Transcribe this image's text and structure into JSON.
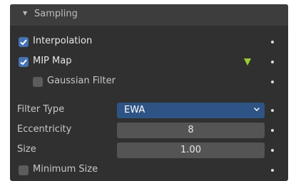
{
  "panel": {
    "title": "Sampling",
    "interpolation": {
      "label": "Interpolation",
      "checked": true
    },
    "mip_map": {
      "label": "MIP Map",
      "checked": true
    },
    "gaussian_filter": {
      "label": "Gaussian Filter",
      "checked": false
    },
    "filter_type": {
      "label": "Filter Type",
      "value": "EWA"
    },
    "eccentricity": {
      "label": "Eccentricity",
      "value": "8"
    },
    "size": {
      "label": "Size",
      "value": "1.00"
    },
    "minimum_size": {
      "label": "Minimum Size",
      "checked": false
    }
  },
  "icons": {
    "collapse": "triangle-down-icon",
    "checkmark": "checkmark-icon",
    "keyframe": "keyframe-icon",
    "dropdown": "chevron-down-icon",
    "animate": "animate-dot-icon"
  },
  "colors": {
    "panel_bg": "#303030",
    "header_bg": "#3d3d3d",
    "checkbox_on": "#4772b3",
    "select_bg": "#2e5485",
    "field_bg": "#545454",
    "keyframe": "#9acd32"
  }
}
